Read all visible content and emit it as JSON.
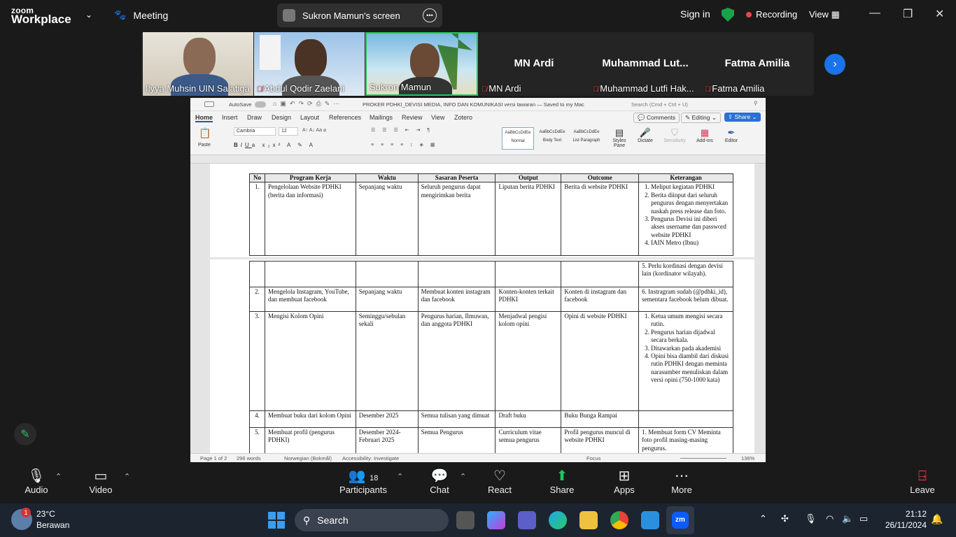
{
  "topbar": {
    "brand_line1": "zoom",
    "brand_line2": "Workplace",
    "meeting_label": "Meeting",
    "screen_label": "Sukron Mamun's screen",
    "signin": "Sign in",
    "recording": "Recording",
    "view": "View"
  },
  "participants": [
    {
      "name": "Ilyya Muhsin UIN Salatiga",
      "muted": false
    },
    {
      "name": "Abdul Qodir Zaelani",
      "muted": true
    },
    {
      "name": "Sukron Mamun",
      "muted": false
    },
    {
      "name": "MN Ardi",
      "display": "MN Ardi",
      "muted": true
    },
    {
      "name": "Muhammad Lutfi Hak...",
      "display": "Muhammad  Lut...",
      "muted": true
    },
    {
      "name": "Fatma Amilia",
      "display": "Fatma Amilia",
      "muted": true
    }
  ],
  "word": {
    "autosave": "AutoSave",
    "doc_title": "PROKER PDHKI_DEVISI MEDIA, INFO DAN KOMUNIKASI versi tawaran — Saved to my Mac",
    "search_placeholder": "Search (Cmd + Ctrl + U)",
    "tabs": [
      "Home",
      "Insert",
      "Draw",
      "Design",
      "Layout",
      "References",
      "Mailings",
      "Review",
      "View",
      "Zotero"
    ],
    "comments": "Comments",
    "editing": "Editing",
    "share": "Share",
    "font": "Cambria",
    "size": "12",
    "paste": "Paste",
    "styles": [
      "Normal",
      "Body Text",
      "List Paragraph"
    ],
    "style_sample": "AaBbCcDdEe",
    "ribbon_right": [
      "Styles Pane",
      "Dictate",
      "Sensitivity",
      "Add-ins",
      "Editor"
    ],
    "status": {
      "page": "Page 1 of 2",
      "words": "296 words",
      "lang": "Norwegian (Bokmål)",
      "access": "Accessibility: Investigate",
      "focus": "Focus",
      "zoom": "136%"
    }
  },
  "table": {
    "headers": [
      "No",
      "Program Kerja",
      "Waktu",
      "Sasaran Peserta",
      "Output",
      "Outcome",
      "Keterangan"
    ],
    "row1": {
      "no": "1.",
      "program": "Pengelolaan Website PDHKI (berita dan informasi)",
      "waktu": "Sepanjang waktu",
      "sasaran": "Seluruh pengurus dapat mengirimkan berita",
      "output": "Liputan berita PDHKI",
      "outcome": "Berita di website PDHKI",
      "ket": [
        "Meliput kegiatan PDHKI",
        "Berita diinput dari seluruh pengurus dengan menyertakan naskah press release dan foto.",
        "Pengurus Devisi ini diberi akses username dan password website PDHKI",
        "IAIN Metro (Ibnu)"
      ]
    },
    "row1b_ket": "5.  Perlu kordinasi dengan devisi lain (kordinator wilayah).",
    "row2": {
      "no": "2.",
      "program": "Mengelola Instagram, YouTube, dan membuat facebook",
      "waktu": "Sepanjang waktu",
      "sasaran": "Membuat konten instagram dan facebook",
      "output": "Konten-konten terkait PDHKI",
      "outcome": "Konten di instagram dan facebook",
      "ket": "6.  Instragram sudah (@pdhki_id), sementara facebook belum dibuat."
    },
    "row3": {
      "no": "3.",
      "program": "Mengisi Kolom Opini",
      "waktu": "Seminggu/sebulan sekali",
      "sasaran": "Pengurus harian, Ilmuwan, dan anggota PDHKI",
      "output": "Menjadwal pengisi kolom opini",
      "outcome": "Opini di website PDHKI",
      "ket": [
        "Ketua umum mengisi secara rutin.",
        "Pengurus harian dijadwal secara berkala.",
        "Ditawarkan pada akademisi",
        "Opini bisa diambil dari diskusi rutin PDHKI dengan meminta narasumber menuliskan dalam versi opini (750-1000 kata)"
      ]
    },
    "row4": {
      "no": "4.",
      "program": "Membuat buku dari kolom Opini",
      "waktu": "Desember 2025",
      "sasaran": "Semua tulisan yang dimuat",
      "output": "Draft buku",
      "outcome": "Buku Bunga Rampai",
      "ket": ""
    },
    "row5": {
      "no": "5.",
      "program": "Membuat profil (pengurus PDHKI)",
      "waktu": "Desember 2024- Februari 2025",
      "sasaran": "Semua Pengurus",
      "output": "Curriculum vitae semua pengurus",
      "outcome": "Profil pengurus muncul di website PDHKI",
      "ket": "1.  Membuat form CV Meminta foto profil masing-masing pengurus."
    }
  },
  "bottombar": {
    "audio": "Audio",
    "video": "Video",
    "participants": "Participants",
    "participants_count": "18",
    "chat": "Chat",
    "react": "React",
    "share": "Share",
    "apps": "Apps",
    "more": "More",
    "leave": "Leave"
  },
  "taskbar": {
    "temp": "23°C",
    "weather": "Berawan",
    "weather_badge": "1",
    "search": "Search",
    "time": "21:12",
    "date": "26/11/2024"
  }
}
